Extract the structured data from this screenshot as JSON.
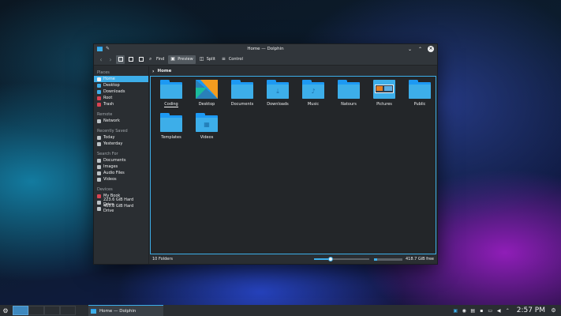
{
  "window": {
    "title": "Home — Dolphin",
    "toolbar": {
      "find_label": "Find",
      "preview_label": "Preview",
      "split_label": "Split",
      "control_label": "Control"
    },
    "breadcrumb": {
      "current": "Home"
    },
    "sidebar": {
      "places_title": "Places",
      "places": [
        "Home",
        "Desktop",
        "Downloads",
        "Root",
        "Trash"
      ],
      "remote_title": "Remote",
      "remote": [
        "Network"
      ],
      "recent_title": "Recently Saved",
      "recent": [
        "Today",
        "Yesterday"
      ],
      "search_title": "Search For",
      "search": [
        "Documents",
        "Images",
        "Audio Files",
        "Videos"
      ],
      "devices_title": "Devices",
      "devices": [
        "My Book",
        "223.6 GiB Hard Drive",
        "465.8 GiB Hard Drive"
      ]
    },
    "files": [
      "Coding",
      "Desktop",
      "Documents",
      "Downloads",
      "Music",
      "Natours",
      "Pictures",
      "Public",
      "Templates",
      "Videos"
    ],
    "status": {
      "summary": "10 Folders",
      "free_space": "418.7 GiB free",
      "zoom_level": 0.3,
      "disk_used_fraction": 0.1
    }
  },
  "taskbar": {
    "task_label": "Home — Dolphin",
    "clock": "2:57 PM"
  },
  "colors": {
    "accent": "#3daee9",
    "folder": "#3daee9",
    "window_bg": "#2a2e32",
    "view_bg": "#232629"
  }
}
